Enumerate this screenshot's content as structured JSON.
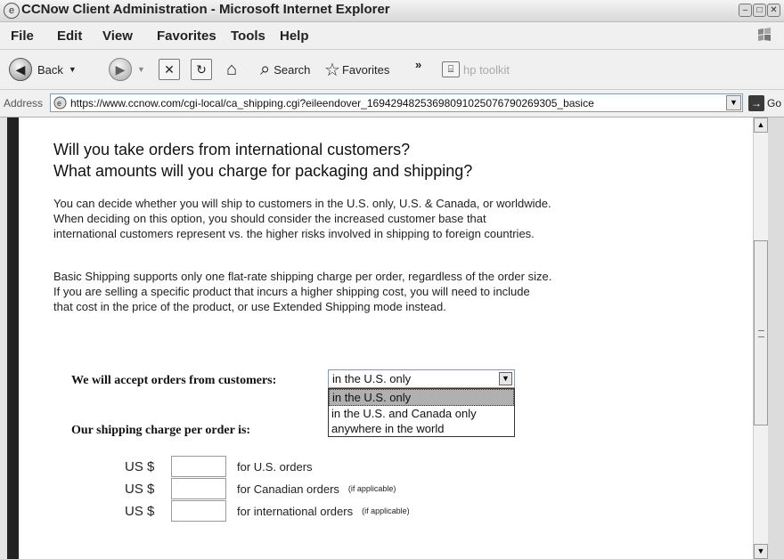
{
  "window": {
    "title": "CCNow Client Administration - Microsoft Internet Explorer"
  },
  "menu": {
    "items": [
      "File",
      "Edit",
      "View",
      "Favorites",
      "Tools",
      "Help"
    ]
  },
  "toolbar": {
    "back_label": "Back",
    "search_label": "Search",
    "favorites_label": "Favorites",
    "chevron": "»",
    "hp_toolkit_label": "hp toolkit"
  },
  "addressbar": {
    "label": "Address",
    "url": "https://www.ccnow.com/cgi-local/ca_shipping.cgi?eileendover_16942948253698091025076790269305_basice",
    "go_label": "Go"
  },
  "page": {
    "heading_line1": "Will you take orders from international customers?",
    "heading_line2": "What amounts will you charge for packaging and shipping?",
    "paragraph1": "You can decide whether you will ship to customers in the U.S. only, U.S. & Canada, or worldwide.  When deciding on this option, you should consider the increased customer base that international customers represent vs. the higher risks involved in shipping to foreign countries.",
    "paragraph2": "Basic Shipping supports only one flat-rate shipping charge per order, regardless of the order size.  If you are selling a specific product that incurs a higher shipping cost, you will need to include that cost in the price of the product, or use Extended Shipping mode instead.",
    "accept_label": "We will accept orders from customers:",
    "accept_select": {
      "selected": "in the U.S. only",
      "options": [
        "in the U.S. only",
        "in the U.S. and Canada only",
        "anywhere in the world"
      ]
    },
    "charge_label": "Our shipping charge per order is:",
    "shipping_rows": [
      {
        "currency": "US  $",
        "label": "for U.S. orders",
        "note": ""
      },
      {
        "currency": "US  $",
        "label": "for Canadian orders",
        "note": "(if applicable)"
      },
      {
        "currency": "US  $",
        "label": "for international orders",
        "note": "(if applicable)"
      }
    ]
  }
}
